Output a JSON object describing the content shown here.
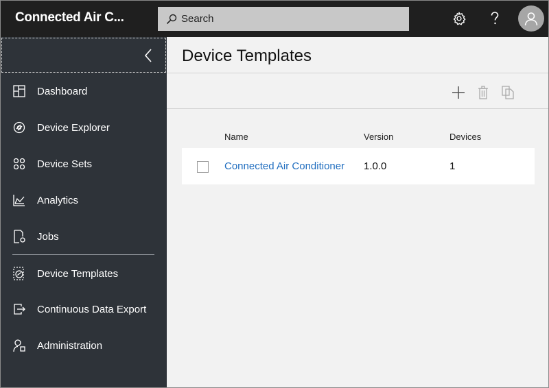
{
  "header": {
    "app_title": "Connected Air C...",
    "search_placeholder": "Search",
    "icons": [
      "search-icon",
      "gear-icon",
      "help-icon",
      "user-avatar-icon"
    ]
  },
  "sidebar": {
    "items": [
      {
        "label": "Dashboard",
        "icon": "dashboard-icon"
      },
      {
        "label": "Device Explorer",
        "icon": "device-explorer-icon"
      },
      {
        "label": "Device Sets",
        "icon": "device-sets-icon"
      },
      {
        "label": "Analytics",
        "icon": "analytics-icon"
      },
      {
        "label": "Jobs",
        "icon": "jobs-icon"
      },
      {
        "label": "Device Templates",
        "icon": "device-templates-icon"
      },
      {
        "label": "Continuous Data Export",
        "icon": "data-export-icon"
      },
      {
        "label": "Administration",
        "icon": "administration-icon"
      }
    ]
  },
  "main": {
    "title": "Device Templates",
    "toolbar": [
      "add-icon",
      "delete-icon",
      "copy-icon"
    ],
    "table": {
      "columns": {
        "name": "Name",
        "version": "Version",
        "devices": "Devices"
      },
      "rows": [
        {
          "name": "Connected Air Conditioner",
          "version": "1.0.0",
          "devices": "1"
        }
      ]
    }
  },
  "colors": {
    "topbar": "#1f1f1f",
    "sidebar": "#2e3339",
    "content_bg": "#f2f2f2",
    "link": "#1f6dbf"
  }
}
